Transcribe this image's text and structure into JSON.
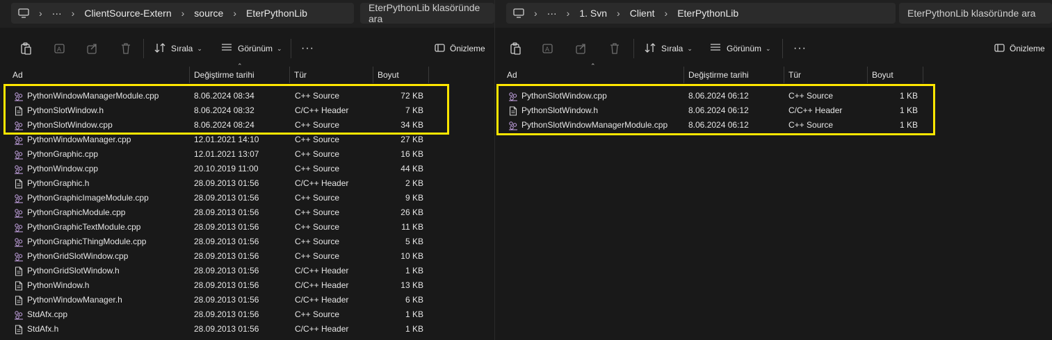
{
  "left": {
    "breadcrumb": [
      "ClientSource-Extern",
      "source",
      "EterPythonLib"
    ],
    "more": "···",
    "search_placeholder": "EterPythonLib klasöründe ara",
    "toolbar": {
      "sort_label": "Sırala",
      "view_label": "Görünüm",
      "more": "···",
      "preview_label": "Önizleme"
    },
    "columns": [
      "Ad",
      "Değiştirme tarihi",
      "Tür",
      "Boyut"
    ],
    "files": [
      {
        "name": "PythonWindowManagerModule.cpp",
        "date": "8.06.2024 08:34",
        "type": "C++ Source",
        "size": "72 KB",
        "icon": "cpp-file-icon"
      },
      {
        "name": "PythonSlotWindow.h",
        "date": "8.06.2024 08:32",
        "type": "C/C++ Header",
        "size": "7 KB",
        "icon": "header-file-icon"
      },
      {
        "name": "PythonSlotWindow.cpp",
        "date": "8.06.2024 08:24",
        "type": "C++ Source",
        "size": "34 KB",
        "icon": "cpp-file-icon"
      },
      {
        "name": "PythonWindowManager.cpp",
        "date": "12.01.2021 14:10",
        "type": "C++ Source",
        "size": "27 KB",
        "icon": "cpp-file-icon"
      },
      {
        "name": "PythonGraphic.cpp",
        "date": "12.01.2021 13:07",
        "type": "C++ Source",
        "size": "16 KB",
        "icon": "cpp-file-icon"
      },
      {
        "name": "PythonWindow.cpp",
        "date": "20.10.2019 11:00",
        "type": "C++ Source",
        "size": "44 KB",
        "icon": "cpp-file-icon"
      },
      {
        "name": "PythonGraphic.h",
        "date": "28.09.2013 01:56",
        "type": "C/C++ Header",
        "size": "2 KB",
        "icon": "header-file-icon"
      },
      {
        "name": "PythonGraphicImageModule.cpp",
        "date": "28.09.2013 01:56",
        "type": "C++ Source",
        "size": "9 KB",
        "icon": "cpp-file-icon"
      },
      {
        "name": "PythonGraphicModule.cpp",
        "date": "28.09.2013 01:56",
        "type": "C++ Source",
        "size": "26 KB",
        "icon": "cpp-file-icon"
      },
      {
        "name": "PythonGraphicTextModule.cpp",
        "date": "28.09.2013 01:56",
        "type": "C++ Source",
        "size": "11 KB",
        "icon": "cpp-file-icon"
      },
      {
        "name": "PythonGraphicThingModule.cpp",
        "date": "28.09.2013 01:56",
        "type": "C++ Source",
        "size": "5 KB",
        "icon": "cpp-file-icon"
      },
      {
        "name": "PythonGridSlotWindow.cpp",
        "date": "28.09.2013 01:56",
        "type": "C++ Source",
        "size": "10 KB",
        "icon": "cpp-file-icon"
      },
      {
        "name": "PythonGridSlotWindow.h",
        "date": "28.09.2013 01:56",
        "type": "C/C++ Header",
        "size": "1 KB",
        "icon": "header-file-icon"
      },
      {
        "name": "PythonWindow.h",
        "date": "28.09.2013 01:56",
        "type": "C/C++ Header",
        "size": "13 KB",
        "icon": "header-file-icon"
      },
      {
        "name": "PythonWindowManager.h",
        "date": "28.09.2013 01:56",
        "type": "C/C++ Header",
        "size": "6 KB",
        "icon": "header-file-icon"
      },
      {
        "name": "StdAfx.cpp",
        "date": "28.09.2013 01:56",
        "type": "C++ Source",
        "size": "1 KB",
        "icon": "cpp-file-icon"
      },
      {
        "name": "StdAfx.h",
        "date": "28.09.2013 01:56",
        "type": "C/C++ Header",
        "size": "1 KB",
        "icon": "header-file-icon"
      }
    ]
  },
  "right": {
    "breadcrumb": [
      "1. Svn",
      "Client",
      "EterPythonLib"
    ],
    "more": "···",
    "search_placeholder": "EterPythonLib klasöründe ara",
    "toolbar": {
      "sort_label": "Sırala",
      "view_label": "Görünüm",
      "more": "···",
      "preview_label": "Önizleme"
    },
    "columns": [
      "Ad",
      "Değiştirme tarihi",
      "Tür",
      "Boyut"
    ],
    "files": [
      {
        "name": "PythonSlotWindow.cpp",
        "date": "8.06.2024 06:12",
        "type": "C++ Source",
        "size": "1 KB",
        "icon": "cpp-file-icon"
      },
      {
        "name": "PythonSlotWindow.h",
        "date": "8.06.2024 06:12",
        "type": "C/C++ Header",
        "size": "1 KB",
        "icon": "header-file-icon"
      },
      {
        "name": "PythonSlotWindowManagerModule.cpp",
        "date": "8.06.2024 06:12",
        "type": "C++ Source",
        "size": "1 KB",
        "icon": "cpp-file-icon"
      }
    ]
  },
  "colors": {
    "highlight": "#ffe600",
    "background": "#191919",
    "address_bar": "#202020"
  }
}
